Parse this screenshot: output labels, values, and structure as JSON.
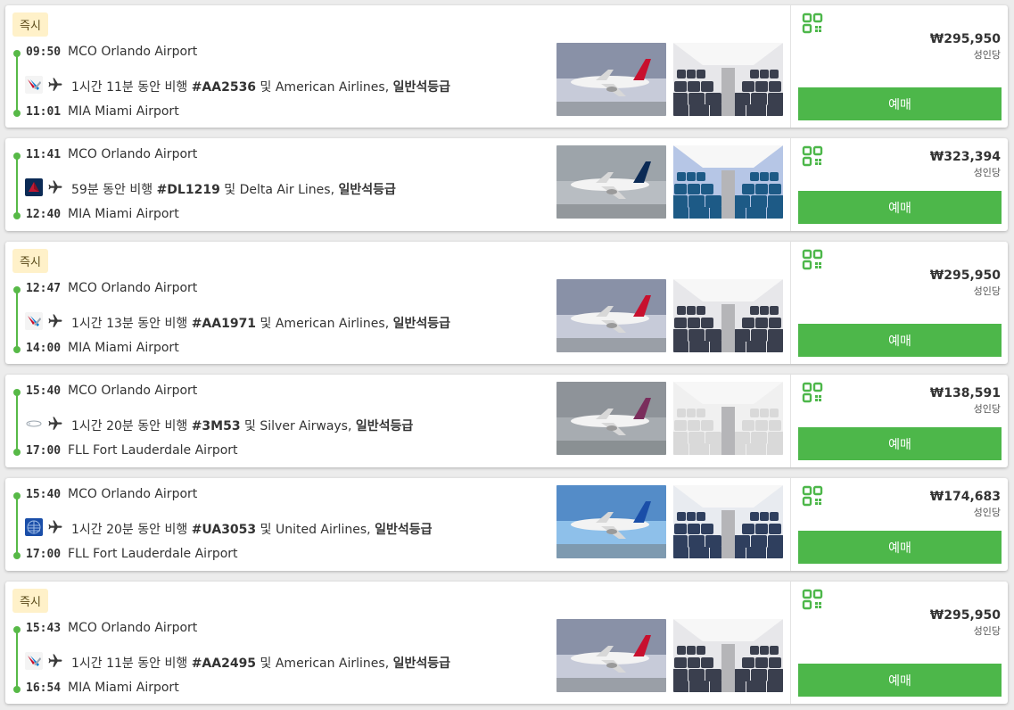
{
  "common": {
    "instant_badge": "즉시",
    "book_label": "예매",
    "per_adult": "성인당"
  },
  "flights": [
    {
      "instant": true,
      "dep_time": "09:50",
      "dep_airport": "MCO Orlando Airport",
      "arr_time": "11:01",
      "arr_airport": "MIA Miami Airport",
      "duration": "1시간 11분 동안 비행",
      "flight_no": "#AA2536",
      "conj": "및",
      "airline": "American Airlines,",
      "cabin": "일반석등급",
      "airline_logo": "american-airlines-logo",
      "price": "₩295,950"
    },
    {
      "instant": false,
      "dep_time": "11:41",
      "dep_airport": "MCO Orlando Airport",
      "arr_time": "12:40",
      "arr_airport": "MIA Miami Airport",
      "duration": "59분 동안 비행",
      "flight_no": "#DL1219",
      "conj": "및",
      "airline": "Delta Air Lines,",
      "cabin": "일반석등급",
      "airline_logo": "delta-logo",
      "price": "₩323,394"
    },
    {
      "instant": true,
      "dep_time": "12:47",
      "dep_airport": "MCO Orlando Airport",
      "arr_time": "14:00",
      "arr_airport": "MIA Miami Airport",
      "duration": "1시간 13분 동안 비행",
      "flight_no": "#AA1971",
      "conj": "및",
      "airline": "American Airlines,",
      "cabin": "일반석등급",
      "airline_logo": "american-airlines-logo",
      "price": "₩295,950"
    },
    {
      "instant": false,
      "dep_time": "15:40",
      "dep_airport": "MCO Orlando Airport",
      "arr_time": "17:00",
      "arr_airport": "FLL Fort Lauderdale Airport",
      "duration": "1시간 20분 동안 비행",
      "flight_no": "#3M53",
      "conj": "및",
      "airline": "Silver Airways,",
      "cabin": "일반석등급",
      "airline_logo": "silver-airways-logo",
      "price": "₩138,591"
    },
    {
      "instant": false,
      "dep_time": "15:40",
      "dep_airport": "MCO Orlando Airport",
      "arr_time": "17:00",
      "arr_airport": "FLL Fort Lauderdale Airport",
      "duration": "1시간 20분 동안 비행",
      "flight_no": "#UA3053",
      "conj": "및",
      "airline": "United Airlines,",
      "cabin": "일반석등급",
      "airline_logo": "united-logo",
      "price": "₩174,683"
    },
    {
      "instant": true,
      "dep_time": "15:43",
      "dep_airport": "MCO Orlando Airport",
      "arr_time": "16:54",
      "arr_airport": "MIA Miami Airport",
      "duration": "1시간 11분 동안 비행",
      "flight_no": "#AA2495",
      "conj": "및",
      "airline": "American Airlines,",
      "cabin": "일반석등급",
      "airline_logo": "american-airlines-logo",
      "price": "₩295,950"
    }
  ],
  "colors": {
    "accent_green": "#4db74a",
    "badge_bg": "#fff1c9",
    "timeline": "#57b947"
  }
}
